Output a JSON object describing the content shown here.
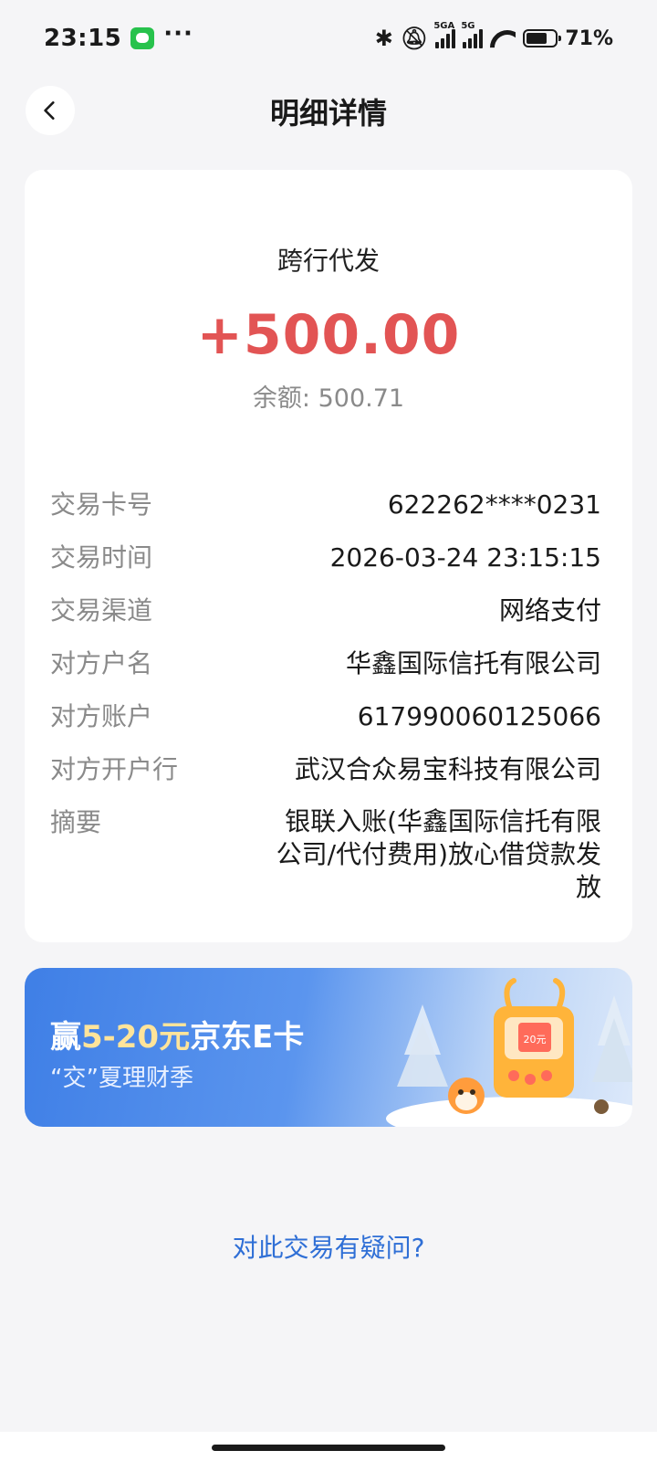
{
  "status_bar": {
    "time": "23:15",
    "signal_labels": [
      "5GA",
      "5G"
    ],
    "wifi_label": "6",
    "battery_percent": "71%",
    "battery_level": 0.71,
    "icons": [
      "messages-icon",
      "bluetooth-icon",
      "mute-icon",
      "signal-icon",
      "wifi-icon",
      "battery-icon"
    ]
  },
  "nav": {
    "title": "明细详情",
    "back_icon": "chevron-left-icon"
  },
  "transaction": {
    "type": "跨行代发",
    "amount": "+500.00",
    "balance_label": "余额: 500.71"
  },
  "details": [
    {
      "label": "交易卡号",
      "value": "622262****0231"
    },
    {
      "label": "交易时间",
      "value": "2026-03-24 23:15:15"
    },
    {
      "label": "交易渠道",
      "value": "网络支付"
    },
    {
      "label": "对方户名",
      "value": "华鑫国际信托有限公司"
    },
    {
      "label": "对方账户",
      "value": "617990060125066"
    },
    {
      "label": "对方开户行",
      "value": "武汉合众易宝科技有限公司"
    },
    {
      "label": "摘要",
      "value": "银联入账(华鑫国际信托有限公司/代付费用)放心借贷款发放"
    }
  ],
  "banner": {
    "title_prefix": "赢",
    "title_highlight": "5-20元",
    "title_suffix": "京东E卡",
    "subtitle": "“交”夏理财季",
    "art_badge": "20元"
  },
  "question_link": "对此交易有疑问?",
  "colors": {
    "amount": "#e25454",
    "link": "#2f6fd6",
    "banner_start": "#3f7fe6",
    "highlight": "#ffe49a"
  }
}
